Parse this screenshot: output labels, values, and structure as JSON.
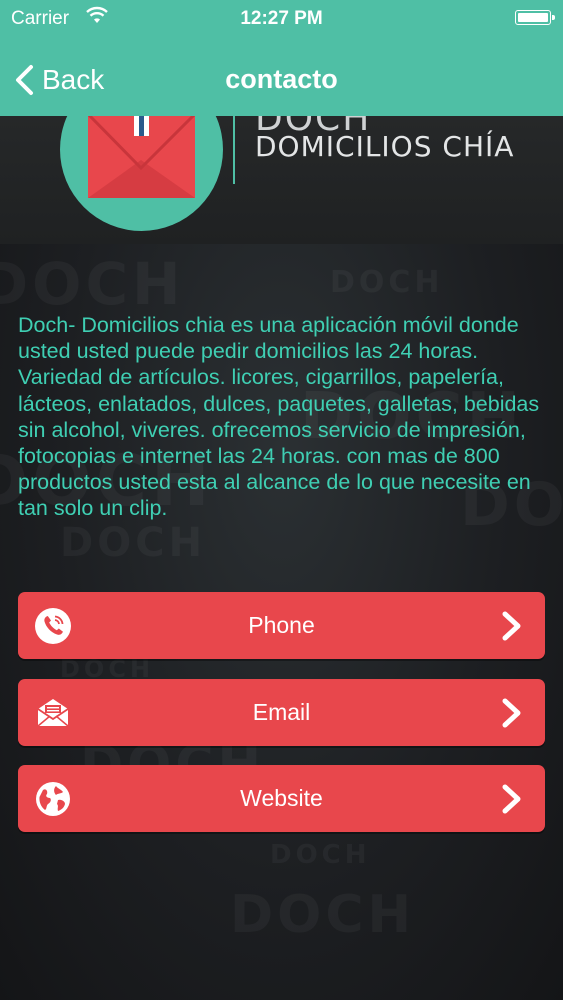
{
  "status_bar": {
    "carrier": "Carrier",
    "time": "12:27 PM"
  },
  "nav": {
    "back_label": "Back",
    "title": "contacto"
  },
  "header": {
    "logo_top_text": "DOCH",
    "logo_subtitle": "DOMICILIOS CHÍA"
  },
  "description": "Doch- Domicilios chia es una aplicación móvil donde usted usted puede pedir domicilios las 24 horas. Variedad de artículos. licores, cigarrillos, papelería, lácteos, enlatados, dulces, paquetes, galletas, bebidas sin alcohol, viveres. ofrecemos servicio de impresión, fotocopias e internet las 24 horas. con mas de 800 productos usted esta al alcance de lo que necesite en tan solo un clip.",
  "buttons": [
    {
      "label": "Phone",
      "icon": "phone-icon"
    },
    {
      "label": "Email",
      "icon": "envelope-icon"
    },
    {
      "label": "Website",
      "icon": "globe-icon"
    }
  ],
  "background_watermark": "DOCH",
  "colors": {
    "accent": "#4fbfa5",
    "button": "#e8474c",
    "description_text": "#3fcfb3",
    "background": "#1b1d20"
  }
}
